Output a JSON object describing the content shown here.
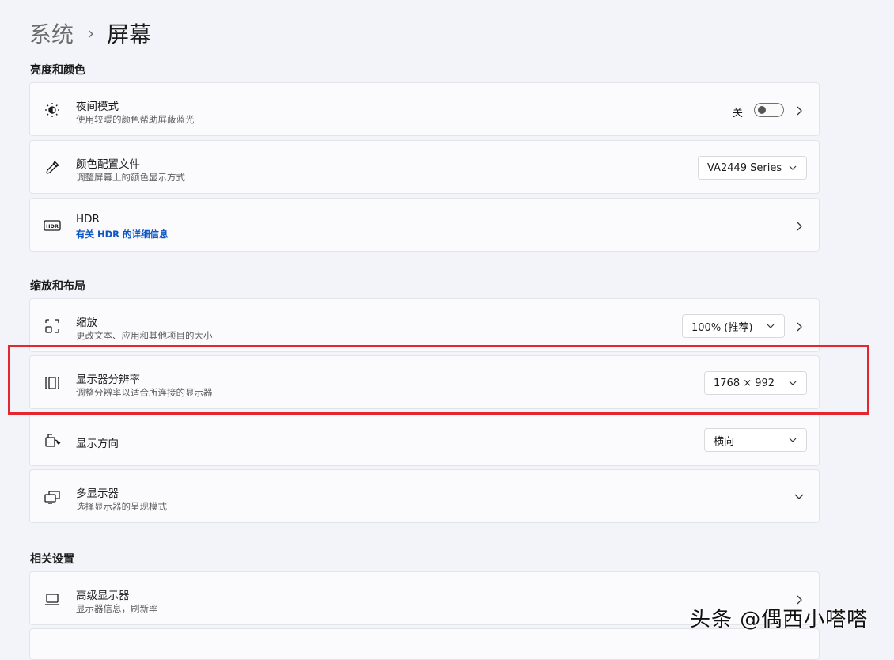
{
  "breadcrumb": {
    "parent": "系统",
    "separator": "›",
    "current": "屏幕"
  },
  "sections": {
    "brightness": "亮度和颜色",
    "scale_layout": "缩放和布局",
    "related": "相关设置"
  },
  "night_light": {
    "title": "夜间模式",
    "subtitle": "使用较暖的颜色帮助屏蔽蓝光",
    "toggle_label": "关",
    "toggle_on": false,
    "icon": "brightness-icon"
  },
  "color_profile": {
    "title": "颜色配置文件",
    "subtitle": "调整屏幕上的颜色显示方式",
    "value": "VA2449 Series",
    "icon": "eyedropper-icon"
  },
  "hdr": {
    "title": "HDR",
    "link": "有关 HDR 的详细信息",
    "icon": "hdr-icon",
    "icon_text": "HDR"
  },
  "scale": {
    "title": "缩放",
    "subtitle": "更改文本、应用和其他项目的大小",
    "value": "100% (推荐)",
    "icon": "scale-icon"
  },
  "resolution": {
    "title": "显示器分辨率",
    "subtitle": "调整分辨率以适合所连接的显示器",
    "value": "1768 × 992",
    "icon": "resolution-icon"
  },
  "orientation": {
    "title": "显示方向",
    "value": "横向",
    "icon": "rotate-icon"
  },
  "multi_display": {
    "title": "多显示器",
    "subtitle": "选择显示器的呈现模式",
    "icon": "multi-monitor-icon"
  },
  "advanced_display": {
    "title": "高级显示器",
    "subtitle": "显示器信息，刷新率",
    "icon": "laptop-icon"
  },
  "watermark": "头条 @偶西小嗒嗒",
  "colors": {
    "background": "#f3f4f9",
    "card": "#fbfbfd",
    "link": "#0b56c4",
    "highlight": "#e4262e"
  }
}
